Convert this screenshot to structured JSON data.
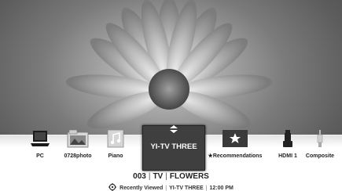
{
  "menu": {
    "items": [
      {
        "label": "PC",
        "icon": "laptop-icon"
      },
      {
        "label": "0728photo",
        "icon": "photo-folder-icon"
      },
      {
        "label": "Piano",
        "icon": "music-file-icon"
      },
      {
        "label": "Recommendations",
        "icon": "star-icon"
      },
      {
        "label": "HDMI 1",
        "icon": "hdmi-icon"
      },
      {
        "label": "Composite",
        "icon": "composite-plug-icon"
      }
    ],
    "selected": {
      "label": "YI-TV THREE",
      "icon": "tv-icon"
    },
    "star_glyph": "★"
  },
  "channel": {
    "number": "003",
    "source": "TV",
    "program": "FLOWERS"
  },
  "status": {
    "label": "Recently Viewed",
    "channel": "YI-TV THREE",
    "time": "12:00 PM"
  },
  "colors": {
    "focus_tile": "#3f3f3f",
    "band": "#ffffff",
    "text": "#222222"
  }
}
